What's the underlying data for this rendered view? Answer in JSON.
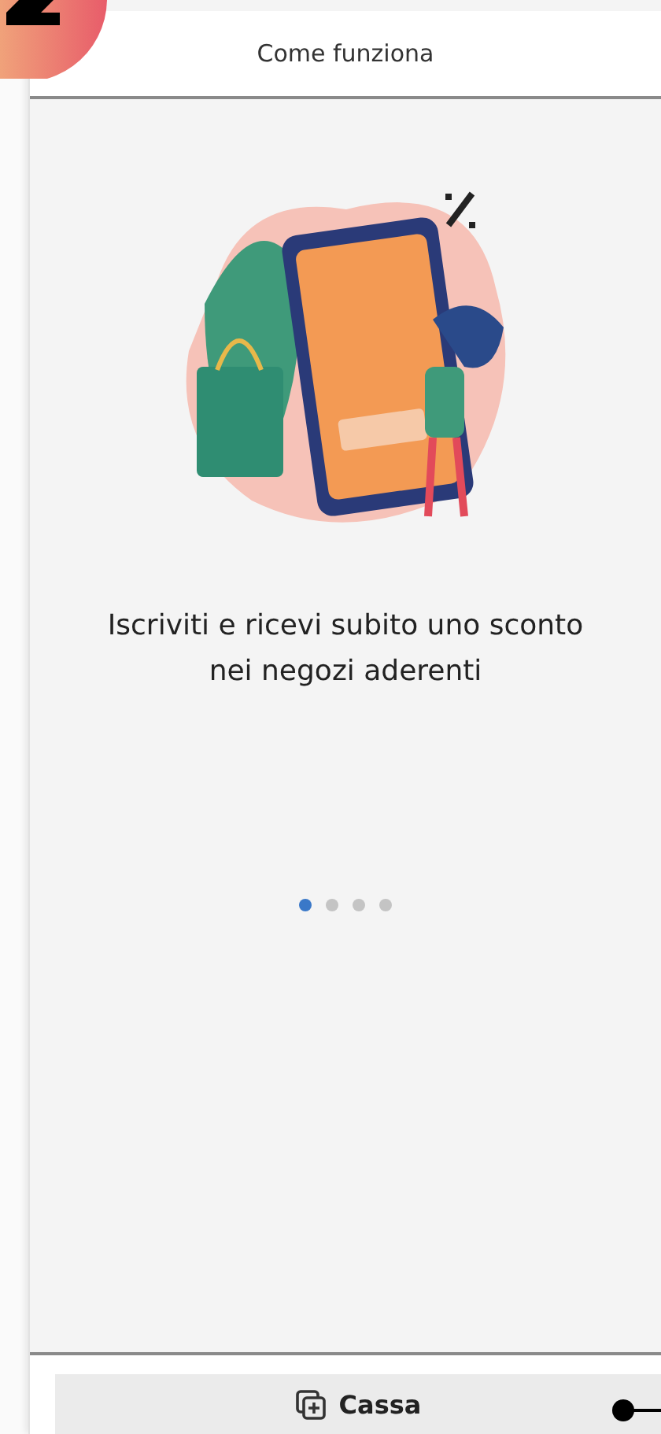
{
  "header": {
    "title": "Come funziona"
  },
  "slide": {
    "caption": "Iscriviti e ricevi subito uno sconto nei negozi aderenti"
  },
  "pager": [
    {
      "selected": true
    },
    {
      "selected": false
    },
    {
      "selected": false
    },
    {
      "selected": false
    }
  ],
  "bottom_button": {
    "label": "Cassa"
  }
}
